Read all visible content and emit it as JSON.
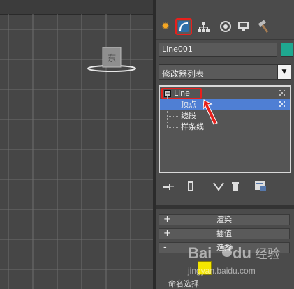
{
  "viewport": {
    "cube_label": "东"
  },
  "command_panel": {
    "tabs": [
      {
        "name": "create-tab",
        "icon": "sun-icon"
      },
      {
        "name": "modify-tab",
        "icon": "modify-curve-icon",
        "active": true
      },
      {
        "name": "hierarchy-tab",
        "icon": "hierarchy-icon"
      },
      {
        "name": "motion-tab",
        "icon": "motion-icon"
      },
      {
        "name": "display-tab",
        "icon": "monitor-icon"
      },
      {
        "name": "utilities-tab",
        "icon": "hammer-icon"
      }
    ],
    "object_name": "Line001",
    "object_color": "#1fa890",
    "modifier_list_label": "修改器列表",
    "stack": {
      "root": "Line",
      "sub_objects": [
        "顶点",
        "线段",
        "样条线"
      ],
      "selected": "顶点"
    },
    "rollouts": [
      {
        "sign": "+",
        "title": "渲染"
      },
      {
        "sign": "+",
        "title": "插值"
      },
      {
        "sign": "-",
        "title": "选择"
      }
    ],
    "bottom_text": "命名选择"
  },
  "watermark": {
    "brand_main": "Bai",
    "brand_du": "du",
    "brand_suffix": "经验",
    "url": "jingyan.baidu.com"
  },
  "colors": {
    "highlight_red": "#e8201c",
    "selection_blue": "#4f7fd4",
    "vertex_yellow": "#f4e600"
  }
}
